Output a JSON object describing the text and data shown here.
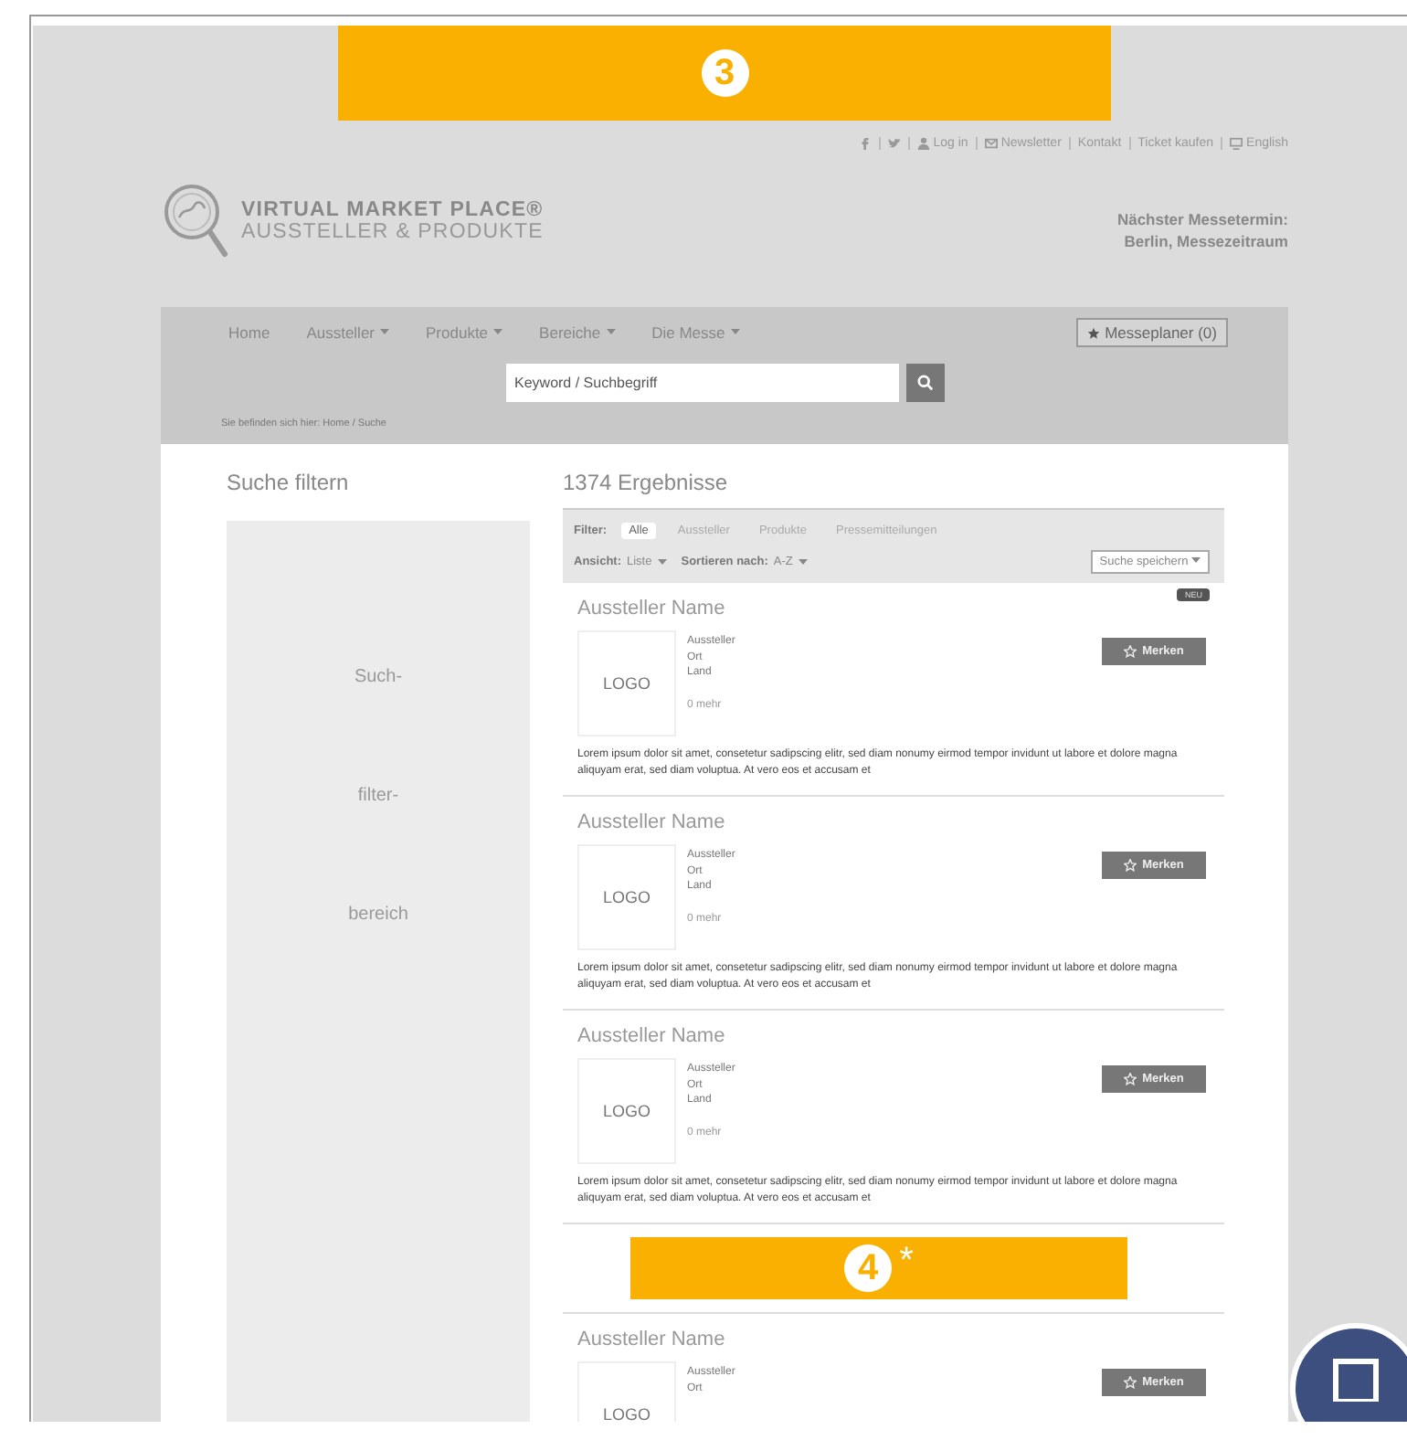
{
  "top_banner": {
    "number": "3"
  },
  "top_links": [
    {
      "kind": "facebook"
    },
    {
      "kind": "bird"
    },
    {
      "kind": "person",
      "label": "Log in"
    },
    {
      "kind": "envelope",
      "label": "Newsletter"
    },
    {
      "kind": "text",
      "label": "Kontakt"
    },
    {
      "kind": "text",
      "label": "Ticket kaufen"
    },
    {
      "kind": "monitor",
      "label": "English"
    }
  ],
  "logo": {
    "title": "VIRTUAL MARKET PLACE®",
    "subtitle": "AUSSTELLER & PRODUKTE"
  },
  "next_fair": {
    "label": "Nächster Messetermin:",
    "value": "Berlin, Messezeitraum"
  },
  "nav": [
    {
      "label": "Home",
      "has_menu": false
    },
    {
      "label": "Aussteller",
      "has_menu": true
    },
    {
      "label": "Produkte",
      "has_menu": true
    },
    {
      "label": "Bereiche",
      "has_menu": true
    },
    {
      "label": "Die Messe",
      "has_menu": true
    }
  ],
  "planner_button": "Messeplaner (0)",
  "search": {
    "placeholder": "Keyword / Suchbegriff"
  },
  "breadcrumb": "Sie befinden sich hier:  Home / Suche",
  "sidebar": {
    "title": "Suche filtern",
    "lines": [
      "Such-",
      "filter-",
      "bereich"
    ]
  },
  "results_title": "1374 Ergebnisse",
  "filter": {
    "label": "Filter:",
    "tabs": [
      {
        "label": "Alle",
        "selected": true
      },
      {
        "label": "Aussteller",
        "selected": false
      },
      {
        "label": "Produkte",
        "selected": false
      },
      {
        "label": "Pressemitteilungen",
        "selected": false
      }
    ],
    "view": {
      "label": "Ansicht:",
      "value": "Liste"
    },
    "sort": {
      "label": "Sortieren nach:",
      "value": "A-Z"
    },
    "save": "Suche speichern"
  },
  "results": [
    {
      "kind": "exhibitor",
      "badge": "NEU",
      "name": "Aussteller Name",
      "logo": "LOGO",
      "details": [
        "Aussteller",
        "Ort",
        "Land"
      ],
      "more": "0 mehr",
      "button": "Merken",
      "text": "Lorem ipsum dolor sit amet, consetetur sadipscing elitr, sed diam nonumy eirmod tempor invidunt ut labore et dolore magna aliquyam erat, sed diam voluptua. At vero eos et accusam et"
    },
    {
      "kind": "exhibitor",
      "name": "Aussteller Name",
      "logo": "LOGO",
      "details": [
        "Aussteller",
        "Ort",
        "Land"
      ],
      "more": "0 mehr",
      "button": "Merken",
      "text": "Lorem ipsum dolor sit amet, consetetur sadipscing elitr, sed diam nonumy eirmod tempor invidunt ut labore et dolore magna aliquyam erat, sed diam voluptua. At vero eos et accusam et"
    },
    {
      "kind": "exhibitor",
      "name": "Aussteller Name",
      "logo": "LOGO",
      "details": [
        "Aussteller",
        "Ort",
        "Land"
      ],
      "more": "0 mehr",
      "button": "Merken",
      "text": "Lorem ipsum dolor sit amet, consetetur sadipscing elitr, sed diam nonumy eirmod tempor invidunt ut labore et dolore magna aliquyam erat, sed diam voluptua. At vero eos et accusam et"
    },
    {
      "kind": "banner",
      "number": "4",
      "note": "*"
    },
    {
      "kind": "exhibitor",
      "name": "Aussteller Name",
      "logo": "LOGO",
      "details": [
        "Aussteller",
        "Ort"
      ],
      "button": "Merken"
    }
  ]
}
